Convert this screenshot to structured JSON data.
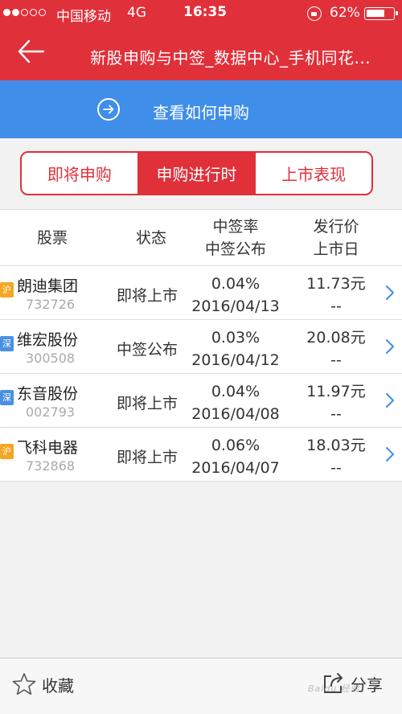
{
  "status_bar": {
    "carrier": "中国移动",
    "network": "4G",
    "time": "16:35",
    "battery": "62%"
  },
  "nav": {
    "title": "新股申购与中签_数据中心_手机同花..."
  },
  "banner": {
    "text": "查看如何申购"
  },
  "tabs": [
    {
      "label": "即将申购",
      "active": false
    },
    {
      "label": "申购进行时",
      "active": true
    },
    {
      "label": "上市表现",
      "active": false
    }
  ],
  "table": {
    "headers": {
      "stock": "股票",
      "status": "状态",
      "rate_line1": "中签率",
      "rate_line2": "中签公布",
      "price_line1": "发行价",
      "price_line2": "上市日"
    },
    "rows": [
      {
        "market": "沪",
        "market_color": "#f5a623",
        "name": "朗迪集团",
        "code": "732726",
        "status": "即将上市",
        "rate": "0.04%",
        "date": "2016/04/13",
        "price": "11.73元",
        "list_date": "--"
      },
      {
        "market": "深",
        "market_color": "#4a90e2",
        "name": "维宏股份",
        "code": "300508",
        "status": "中签公布",
        "rate": "0.03%",
        "date": "2016/04/12",
        "price": "20.08元",
        "list_date": "--"
      },
      {
        "market": "深",
        "market_color": "#4a90e2",
        "name": "东音股份",
        "code": "002793",
        "status": "即将上市",
        "rate": "0.04%",
        "date": "2016/04/08",
        "price": "11.97元",
        "list_date": "--"
      },
      {
        "market": "沪",
        "market_color": "#f5a623",
        "name": "飞科电器",
        "code": "732868",
        "status": "即将上市",
        "rate": "0.06%",
        "date": "2016/04/07",
        "price": "18.03元",
        "list_date": "--"
      }
    ]
  },
  "footer": {
    "favorite_label": "收藏",
    "share_label": "分享"
  },
  "watermark": "Baidu 经验",
  "icons": {
    "back": "arrow-left-icon",
    "banner": "arrow-right-circle-icon",
    "row": "chevron-right-icon",
    "favorite": "star-outline-icon",
    "share": "share-icon"
  },
  "colors": {
    "primary_red": "#e0303a",
    "banner_blue": "#3f8ee9",
    "chevron_blue": "#3f8ee9"
  }
}
